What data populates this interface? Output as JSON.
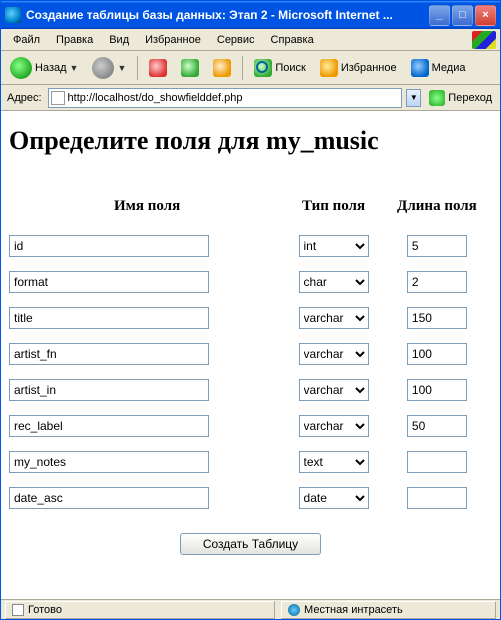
{
  "window": {
    "title": "Создание таблицы базы данных: Этап 2 - Microsoft Internet ..."
  },
  "menu": {
    "file": "Файл",
    "edit": "Правка",
    "view": "Вид",
    "favorites": "Избранное",
    "tools": "Сервис",
    "help": "Справка"
  },
  "toolbar": {
    "back": "Назад",
    "search": "Поиск",
    "favorites": "Избранное",
    "media": "Медиа"
  },
  "address": {
    "label": "Адрес:",
    "url": "http://localhost/do_showfielddef.php",
    "go": "Переход"
  },
  "page": {
    "heading": "Определите поля для my_music",
    "col_name": "Имя поля",
    "col_type": "Тип поля",
    "col_len": "Длина поля",
    "submit": "Создать Таблицу",
    "type_options": [
      "int",
      "char",
      "varchar",
      "text",
      "date"
    ],
    "rows": [
      {
        "name": "id",
        "type": "int",
        "len": "5"
      },
      {
        "name": "format",
        "type": "char",
        "len": "2"
      },
      {
        "name": "title",
        "type": "varchar",
        "len": "150"
      },
      {
        "name": "artist_fn",
        "type": "varchar",
        "len": "100"
      },
      {
        "name": "artist_in",
        "type": "varchar",
        "len": "100"
      },
      {
        "name": "rec_label",
        "type": "varchar",
        "len": "50"
      },
      {
        "name": "my_notes",
        "type": "text",
        "len": ""
      },
      {
        "name": "date_asc",
        "type": "date",
        "len": ""
      }
    ]
  },
  "status": {
    "ready": "Готово",
    "zone": "Местная интрасеть"
  }
}
